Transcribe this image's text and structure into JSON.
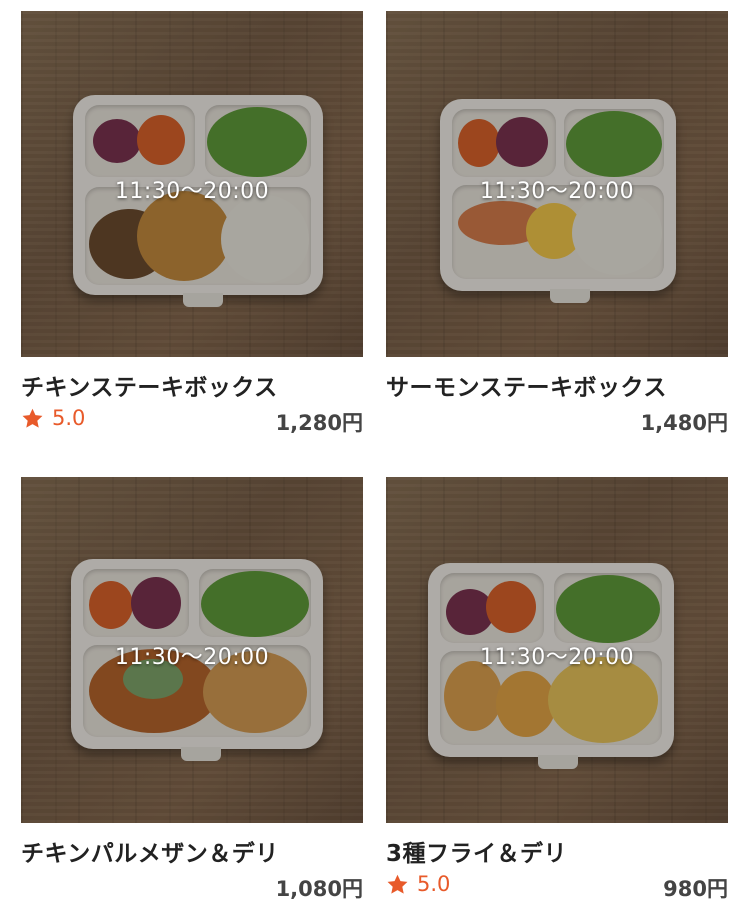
{
  "items": [
    {
      "hours": "11:30〜20:00",
      "name": "チキンステーキボックス",
      "rating": "5.0",
      "price": "1,280円",
      "has_rating": true
    },
    {
      "hours": "11:30〜20:00",
      "name": "サーモンステーキボックス",
      "rating": "",
      "price": "1,480円",
      "has_rating": false
    },
    {
      "hours": "11:30〜20:00",
      "name": "チキンパルメザン＆デリ",
      "rating": "",
      "price": "1,080円",
      "has_rating": false
    },
    {
      "hours": "11:30〜20:00",
      "name": "3種フライ＆デリ",
      "rating": "5.0",
      "price": "980円",
      "has_rating": true
    }
  ],
  "colors": {
    "rating": "#e85a2a",
    "name": "#222222",
    "price": "#444444"
  },
  "icons": {
    "rating": "star-icon"
  }
}
